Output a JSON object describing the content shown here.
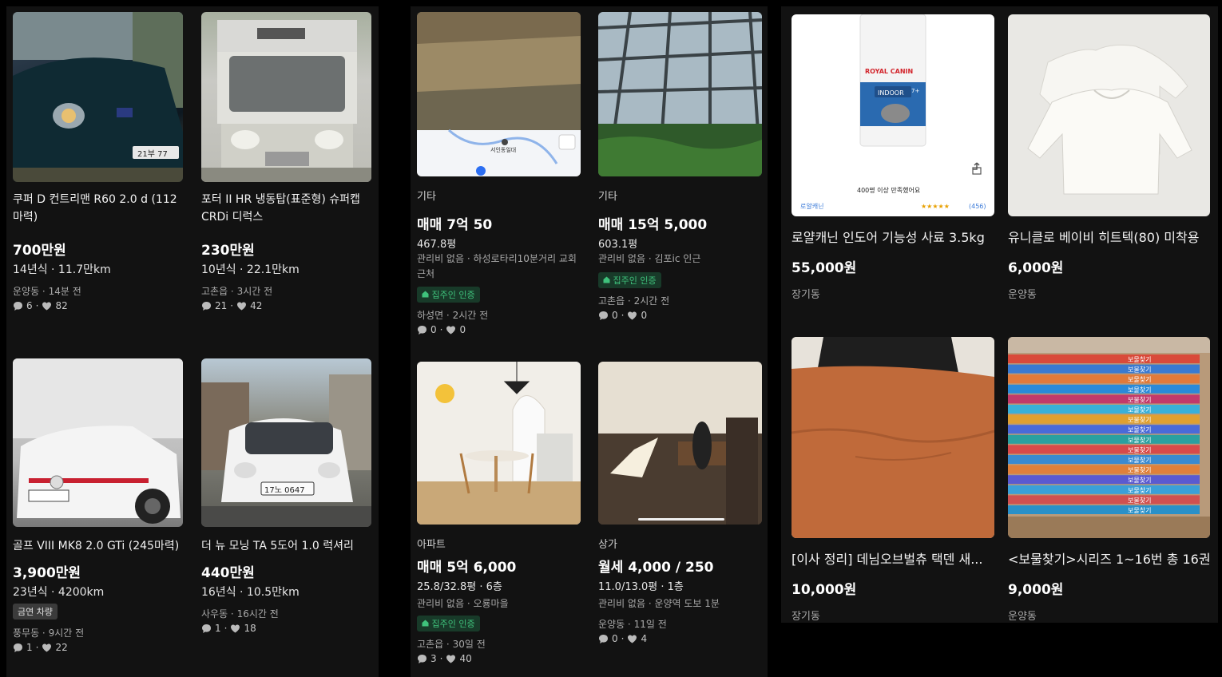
{
  "cars": [
    {
      "title": "쿠퍼 D 컨트리맨 R60 2.0 d (112마력)",
      "price": "700만원",
      "spec": "14년식 · 11.7만km",
      "location": "운양동 · 14분 전",
      "chats": "6",
      "likes": "82"
    },
    {
      "title": "포터 II HR 냉동탑(표준형) 슈퍼캡 CRDi 디럭스",
      "price": "230만원",
      "spec": "10년식 · 22.1만km",
      "location": "고촌읍 · 3시간 전",
      "chats": "21",
      "likes": "42"
    },
    {
      "title": "골프 VIII MK8 2.0 GTi (245마력)",
      "price": "3,900만원",
      "spec": "23년식 · 4200km",
      "badge": "금연 차량",
      "location": "풍무동 · 9시간 전",
      "chats": "1",
      "likes": "22"
    },
    {
      "title": "더 뉴 모닝 TA 5도어 1.0 럭셔리",
      "price": "440만원",
      "spec": "16년식 · 10.5만km",
      "location": "사우동 · 16시간 전",
      "chats": "1",
      "likes": "18"
    }
  ],
  "estate": [
    {
      "category": "기타",
      "price": "매매 7억 50",
      "size": "467.8평",
      "detail": "관리비 없음 · 하성로타리10분거리 교회근처",
      "badge": "집주인 인증",
      "location": "하성면 · 2시간 전",
      "chats": "0",
      "likes": "0",
      "map_label": "서인동일대"
    },
    {
      "category": "기타",
      "price": "매매 15억 5,000",
      "size": "603.1평",
      "detail": "관리비 없음 · 김포ic 인근",
      "badge": "집주인 인증",
      "location": "고촌읍 · 2시간 전",
      "chats": "0",
      "likes": "0"
    },
    {
      "category": "아파트",
      "price": "매매 5억 6,000",
      "size": "25.8/32.8평 · 6층",
      "detail": "관리비 없음 · 오룡마을",
      "badge": "집주인 인증",
      "location": "고촌읍 · 30일 전",
      "chats": "3",
      "likes": "40"
    },
    {
      "category": "상가",
      "price": "월세 4,000 / 250",
      "size": "11.0/13.0평 · 1층",
      "detail": "관리비 없음 · 운양역 도보 1분",
      "location": "운양동 · 11일 전",
      "chats": "0",
      "likes": "4"
    }
  ],
  "goods": [
    {
      "title": "로얄캐닌 인도어 기능성 사료 3.5kg",
      "price": "55,000원",
      "location": "장기동",
      "img_brand": "ROYAL CANIN",
      "img_product": "INDOOR",
      "img_age": "7+",
      "img_caption": "400명 이상 만족했어요",
      "img_store": "로얄캐닌",
      "img_rating": "(456)"
    },
    {
      "title": "유니클로 베이비 히트텍(80) 미착용",
      "price": "6,000원",
      "location": "운양동"
    },
    {
      "title": "[이사 정리] 데님오브벌츄 택덴 새...",
      "price": "10,000원",
      "location": "장기동"
    },
    {
      "title": "<보물찾기>시리즈 1~16번 총 16권",
      "price": "9,000원",
      "location": "운양동",
      "book_title": "보물찾기"
    }
  ],
  "car_plates": [
    "21부 77",
    "17노 0647"
  ],
  "colors": {
    "panel": "#121212",
    "badge_green": "#3fc27c",
    "badge_gray": "#3b3b3b"
  },
  "icons": [
    "chat-icon",
    "heart-icon",
    "house-check-icon",
    "share-icon",
    "location-pin-icon"
  ]
}
